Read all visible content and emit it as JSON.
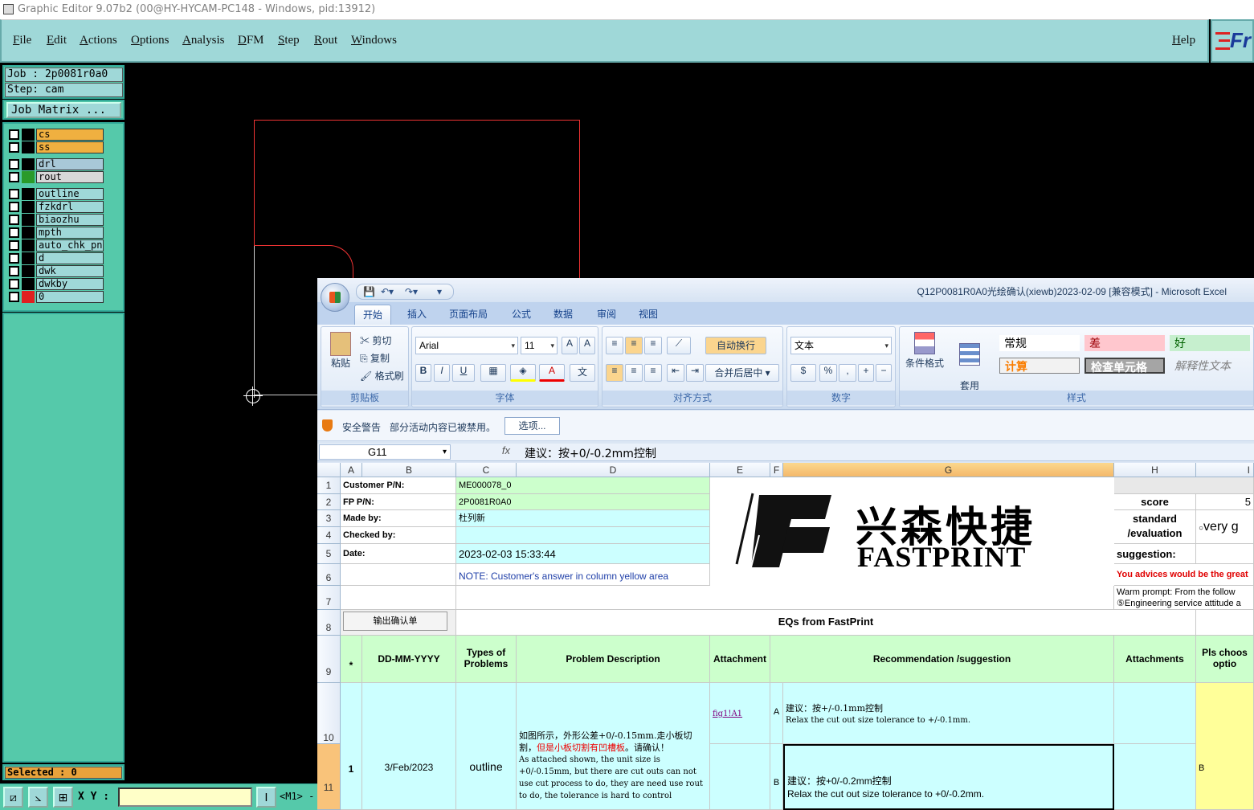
{
  "ge": {
    "title": "Graphic Editor 9.07b2 (00@HY-HYCAM-PC148 - Windows, pid:13912)",
    "menu": [
      "File",
      "Edit",
      "Actions",
      "Options",
      "Analysis",
      "DFM",
      "Step",
      "Rout",
      "Windows"
    ],
    "help": "Help",
    "logo_text": "Fr",
    "job": "Job : 2p0081r0a0",
    "step": "Step: cam",
    "job_matrix": "Job Matrix ...",
    "layers": [
      {
        "name": "cs",
        "color": "#000000",
        "bg": "#f0b040"
      },
      {
        "name": "ss",
        "color": "#000000",
        "bg": "#f0b040"
      },
      {
        "name": "drl",
        "color": "#000000",
        "bg": "#a8c8d8"
      },
      {
        "name": "rout",
        "color": "#2a9a2a",
        "bg": "#d8d8d8"
      },
      {
        "name": "outline",
        "color": "#000000",
        "bg": "#9fd8d8"
      },
      {
        "name": "fzkdrl",
        "color": "#000000",
        "bg": "#9fd8d8"
      },
      {
        "name": "biaozhu",
        "color": "#000000",
        "bg": "#9fd8d8"
      },
      {
        "name": "mpth",
        "color": "#000000",
        "bg": "#9fd8d8"
      },
      {
        "name": "auto_chk_pn",
        "color": "#000000",
        "bg": "#9fd8d8"
      },
      {
        "name": "d",
        "color": "#000000",
        "bg": "#9fd8d8"
      },
      {
        "name": "dwk",
        "color": "#000000",
        "bg": "#9fd8d8"
      },
      {
        "name": "dwkby",
        "color": "#000000",
        "bg": "#9fd8d8"
      },
      {
        "name": "0",
        "color": "#e02020",
        "bg": "#9fd8d8"
      }
    ],
    "selected": "Selected : 0",
    "xy_label": "X Y :",
    "m1": "<M1> -"
  },
  "excel": {
    "title": "Q12P0081R0A0光绘确认(xiewb)2023-02-09  [兼容模式] - Microsoft Excel",
    "tabs": [
      "开始",
      "插入",
      "页面布局",
      "公式",
      "数据",
      "审阅",
      "视图"
    ],
    "clipboard": {
      "paste": "粘贴",
      "cut": "剪切",
      "copy": "复制",
      "format_painter": "格式刷",
      "label": "剪贴板"
    },
    "font": {
      "name": "Arial",
      "size": "11",
      "label": "字体",
      "bold": "B",
      "italic": "I",
      "underline": "U"
    },
    "align": {
      "wrap": "自动换行",
      "merge": "合并后居中",
      "label": "对齐方式"
    },
    "number": {
      "format": "文本",
      "label": "数字",
      "percent": "%",
      "comma": ","
    },
    "styles": {
      "cond": "条件格式",
      "table": "套用\n表格格式",
      "normal": "常规",
      "bad": "差",
      "good": "好",
      "calc": "计算",
      "check": "检查单元格",
      "explain": "解释性文本",
      "label": "样式"
    },
    "security": {
      "title": "安全警告",
      "msg": "部分活动内容已被禁用。",
      "button": "选项..."
    },
    "namebox": "G11",
    "fx": "fx",
    "formula": "建议：按+0/-0.2mm控制",
    "cols": [
      "A",
      "B",
      "C",
      "D",
      "E",
      "F",
      "G",
      "H",
      "I"
    ],
    "rows": [
      "1",
      "2",
      "3",
      "4",
      "5",
      "6",
      "7",
      "8",
      "9",
      "10",
      "11"
    ],
    "info": [
      {
        "label": "Customer P/N:",
        "value": "ME000078_0"
      },
      {
        "label": "FP P/N:",
        "value": "2P0081R0A0"
      },
      {
        "label": "Made by:",
        "value": "杜列新"
      },
      {
        "label": "Checked by:",
        "value": ""
      },
      {
        "label": "Date:",
        "value": "2023-02-03 15:33:44"
      }
    ],
    "note": "NOTE: Customer's  answer in column yellow area",
    "logo_cn": "兴森快捷",
    "logo_en": "FASTPRINT",
    "score_label": "score",
    "score_value": "5",
    "standard": "standard\n/evaluation",
    "very": "very g",
    "suggestion": "suggestion:",
    "advice": "You advices would be the great",
    "warm1": "Warm prompt:  From the follow",
    "warm2": "⑤Engineering service attitude a",
    "confirm_btn": "输出确认单",
    "eqs": "EQs from FastPrint",
    "headers": {
      "star": "*",
      "date": "DD-MM-YYYY",
      "types": "Types of\nProblems",
      "problem": "Problem Description",
      "attach": "Attachment",
      "rec": "Recommendation /suggestion",
      "attachments": "Attachments",
      "pls": "Pls choos\noptio"
    },
    "row10": {
      "num": "1",
      "date": "3/Feb/2023",
      "type": "outline",
      "desc_cn": "如图所示，外形公差+0/-0.15mm.走小板切割，",
      "desc_red": "但是小板切割有凹槽板",
      "desc_cn2": "。请确认！",
      "desc_en": "As attached shown, the unit size is +0/-0.15mm, but there are cut outs can not use cut process to do, they are need use rout to do, the tolerance is hard to control",
      "link": "fig1!A1",
      "optA": "A",
      "recA_cn": "建议：按+/-0.1mm控制",
      "recA_en": "Relax the cut out size tolerance to +/-0.1mm.",
      "optB": "B",
      "recB_cn": "建议：按+0/-0.2mm控制",
      "recB_en": "Relax the cut out size tolerance to +0/-0.2mm.",
      "choice": "B"
    }
  }
}
